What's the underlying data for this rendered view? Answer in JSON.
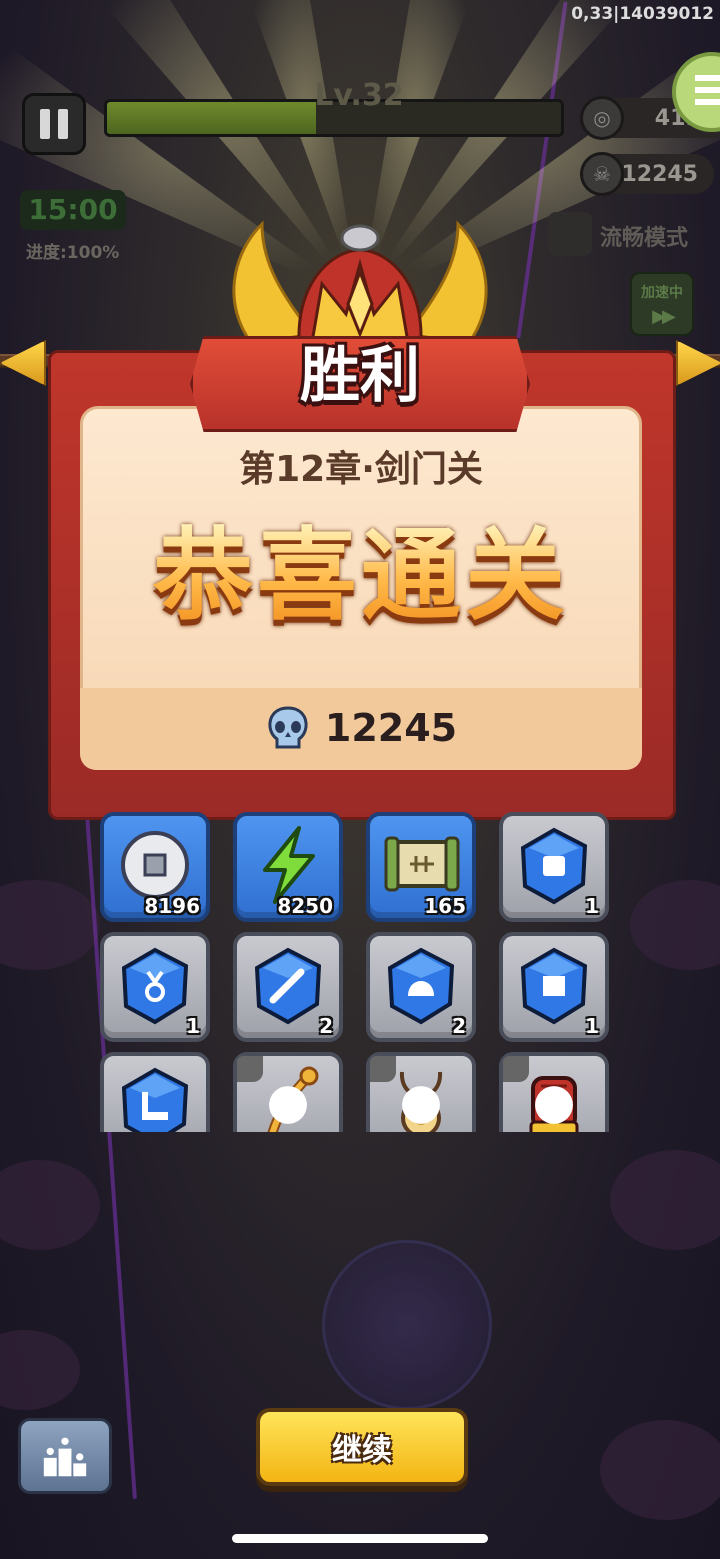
{
  "hud": {
    "top_id": "0,33|14039012",
    "level_label": "Lv.32",
    "xp_fraction": 0.46,
    "coins": "4196",
    "skulls": "12245",
    "timer": "15:00",
    "progress": "进度:100%",
    "smooth_mode": "流畅模式",
    "speed_label": "加速中",
    "speed_icon": "▶▶"
  },
  "dialog": {
    "title": "胜利",
    "chapter": "第12章·剑门关",
    "congrats": "恭喜通关",
    "skull_total": "12245"
  },
  "rewards": [
    {
      "icon": "silver-coin-icon",
      "style": "blue",
      "qty": "8196"
    },
    {
      "icon": "energy-bolt-icon",
      "style": "blue",
      "qty": "8250"
    },
    {
      "icon": "scroll-map-icon",
      "style": "blue",
      "qty": "165"
    },
    {
      "icon": "armor-gem-icon",
      "style": "grey",
      "qty": "1"
    },
    {
      "icon": "medal-gem-icon",
      "style": "grey",
      "qty": "1"
    },
    {
      "icon": "sword-gem-icon",
      "style": "grey",
      "qty": "2"
    },
    {
      "icon": "helmet-gem-icon",
      "style": "grey",
      "qty": "2"
    },
    {
      "icon": "scroll-gem-icon",
      "style": "grey",
      "qty": "1"
    },
    {
      "icon": "boot-gem-icon",
      "style": "grey",
      "qty": ""
    },
    {
      "icon": "golden-staff-icon",
      "style": "grey",
      "qty": ""
    },
    {
      "icon": "amulet-necklace-icon",
      "style": "grey",
      "qty": ""
    },
    {
      "icon": "gauntlet-icon",
      "style": "grey",
      "qty": ""
    }
  ],
  "buttons": {
    "continue": "继续"
  },
  "colors": {
    "banner_red": "#b8322a",
    "panel_cream": "#fde8d0",
    "button_yellow": "#f3b514",
    "slot_blue": "#3f82e0"
  }
}
